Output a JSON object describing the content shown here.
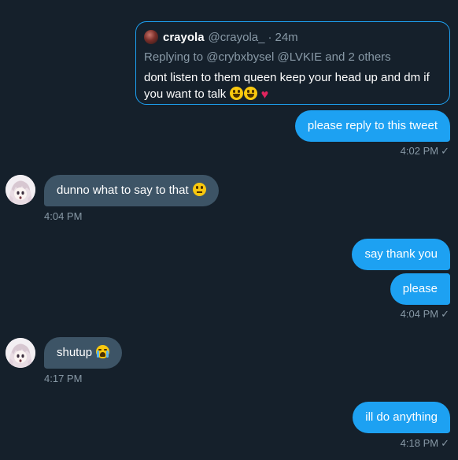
{
  "quoted_tweet": {
    "name": "crayola",
    "handle": "@crayola_",
    "dot": "·",
    "time": "24m",
    "replying_to": "Replying to @crybxbysel @LVKIE and 2 others",
    "text": "dont listen to them queen keep your head up and dm if you want to talk",
    "emojis": [
      "grinning-face-icon",
      "grinning-face-icon",
      "red-heart-icon"
    ]
  },
  "messages": [
    {
      "id": "m1",
      "direction": "sent",
      "text": "please reply to this tweet",
      "time": "4:02 PM"
    },
    {
      "id": "m2",
      "direction": "received",
      "text": "dunno what to say to that",
      "emoji": "neutral-face-icon",
      "time": "4:04 PM"
    },
    {
      "id": "m3",
      "direction": "sent",
      "text": "say thank you"
    },
    {
      "id": "m4",
      "direction": "sent",
      "text": "please",
      "time": "4:04 PM"
    },
    {
      "id": "m5",
      "direction": "received",
      "text": "shutup",
      "emoji": "loudly-crying-face-icon",
      "time": "4:17 PM"
    },
    {
      "id": "m6",
      "direction": "sent",
      "text": "ill do anything",
      "time": "4:18 PM"
    }
  ],
  "status_icon": "checkmark-icon",
  "colors": {
    "background": "#15202b",
    "sent_bubble": "#1da1f2",
    "received_bubble": "#3d5466",
    "muted_text": "#8899a6",
    "quote_border": "#1da1f2"
  }
}
